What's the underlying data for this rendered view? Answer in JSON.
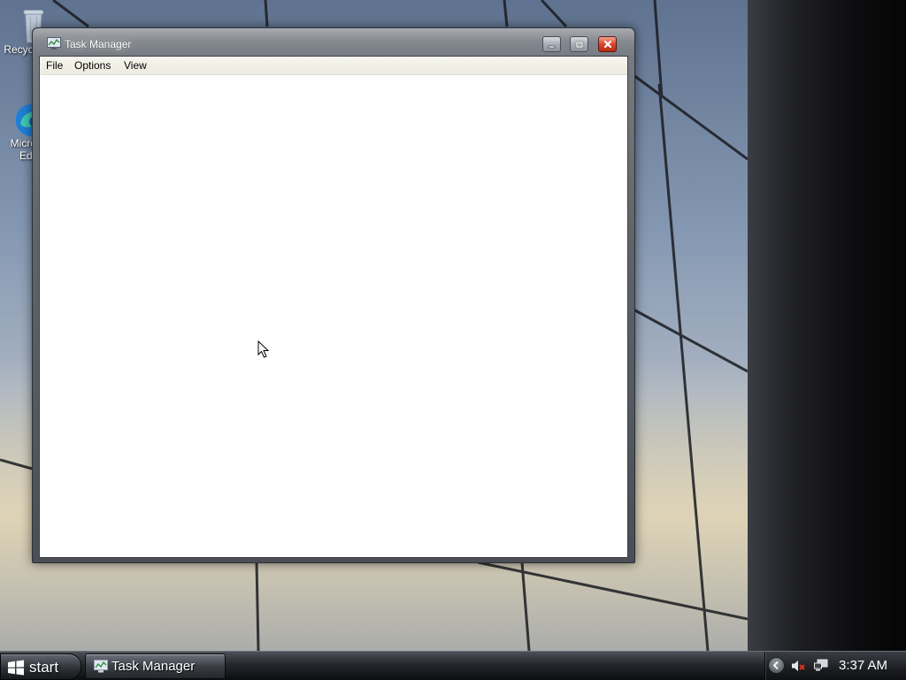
{
  "desktop": {
    "icons": [
      {
        "label": "Recycle Bin",
        "icon": "recycle-bin-icon"
      },
      {
        "label": "Microsoft Edge",
        "icon": "edge-icon"
      }
    ]
  },
  "window": {
    "title": "Task Manager",
    "icon": "task-manager-icon",
    "menu": {
      "file": "File",
      "options": "Options",
      "view": "View"
    },
    "controls": {
      "minimize": "minimize-icon",
      "maximize": "maximize-icon",
      "close": "close-icon"
    }
  },
  "taskbar": {
    "start_label": "start",
    "tasks": [
      {
        "label": "Task Manager",
        "icon": "task-manager-icon"
      }
    ],
    "tray": {
      "expand_icon": "chevron-left-icon",
      "volume_icon": "volume-muted-icon",
      "network_icon": "network-icon"
    },
    "clock": "3:37 AM"
  },
  "colors": {
    "close_button": "#d8472d",
    "taskbar": "#1c1e22",
    "menubar": "#f2f1e8"
  }
}
